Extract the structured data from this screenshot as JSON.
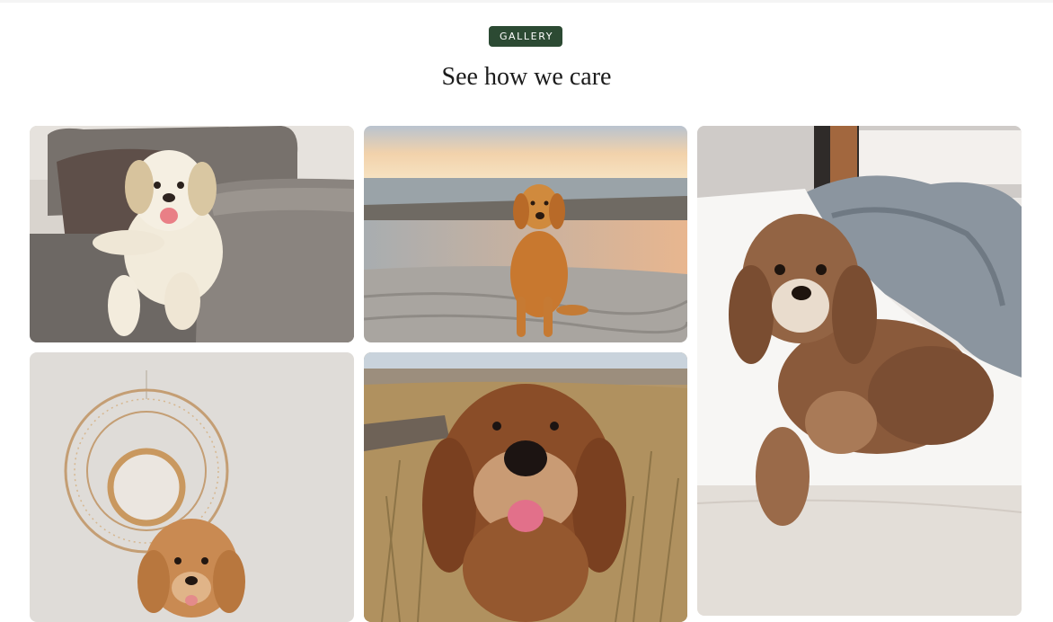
{
  "section": {
    "badge": "GALLERY",
    "title": "See how we care"
  },
  "colors": {
    "badge_bg": "#2c4a33",
    "badge_text": "#ffffff",
    "title_text": "#1c1c1c"
  },
  "gallery": {
    "photos": [
      {
        "subject": "cream doodle dog on grey sofa"
      },
      {
        "subject": "golden retriever sitting on beach at sunset"
      },
      {
        "subject": "brown cavapoo lying on white bed"
      },
      {
        "subject": "apricot doodle puppy under rattan wall mirror"
      },
      {
        "subject": "brown doodle close-up in dry grass field"
      }
    ]
  }
}
